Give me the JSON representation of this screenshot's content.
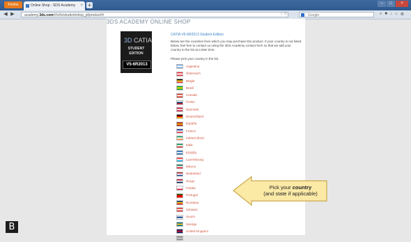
{
  "browser": {
    "menu_button": "Firefox",
    "tab_title": "Online Shop - SDS Academy",
    "url_prefix": "academy.",
    "url_domain": "3ds.com",
    "url_path": "/#/s/fs/student/shop_pl/product/4",
    "search_placeholder": "Google"
  },
  "shop": {
    "heading": "3DS ACADEMY ONLINE SHOP",
    "box": {
      "logo": "CATIA",
      "student": "STUDENT",
      "edition": "EDITION",
      "version": "V5-6R2013"
    },
    "product_title": "CATIA V5-6R2013 Student Edition",
    "intro": "Below are the countries from which you may purchase this product. If your country is not listed below, feel free to contact us using the 3DS Academy contact form so that we add your country to the list at a later time.",
    "instruction": "Please pick your country in the list.",
    "countries": [
      {
        "name": "Argentina",
        "flag": [
          "#74acdf",
          "#ffffff",
          "#74acdf"
        ]
      },
      {
        "name": "Österreich",
        "flag": [
          "#ed2939",
          "#ffffff",
          "#ed2939"
        ]
      },
      {
        "name": "België",
        "flag": [
          "#000000",
          "#fdda24",
          "#ef3340"
        ]
      },
      {
        "name": "Brazil",
        "flag": [
          "#009c3b",
          "#ffdf00",
          "#009c3b"
        ]
      },
      {
        "name": "Canada",
        "flag": [
          "#d52b1e",
          "#ffffff",
          "#d52b1e"
        ]
      },
      {
        "name": "Česko",
        "flag": [
          "#ffffff",
          "#11457e",
          "#d7141a"
        ]
      },
      {
        "name": "Danmark",
        "flag": [
          "#c60c30",
          "#ffffff",
          "#c60c30"
        ]
      },
      {
        "name": "Deutschland",
        "flag": [
          "#000000",
          "#dd0000",
          "#ffce00"
        ]
      },
      {
        "name": "España",
        "flag": [
          "#aa151b",
          "#f1bf00",
          "#aa151b"
        ]
      },
      {
        "name": "France",
        "flag": [
          "#002395",
          "#ffffff",
          "#ed2939"
        ]
      },
      {
        "name": "Ireland (Éire)",
        "flag": [
          "#169b62",
          "#ffffff",
          "#ff883e"
        ]
      },
      {
        "name": "Italia",
        "flag": [
          "#009246",
          "#ffffff",
          "#ce2b37"
        ]
      },
      {
        "name": "Eλλάδα",
        "flag": [
          "#0d5eaf",
          "#ffffff",
          "#0d5eaf"
        ]
      },
      {
        "name": "Luxembourg",
        "flag": [
          "#ed2939",
          "#ffffff",
          "#00a1de"
        ]
      },
      {
        "name": "México",
        "flag": [
          "#006847",
          "#ffffff",
          "#ce1126"
        ]
      },
      {
        "name": "Nederland",
        "flag": [
          "#ae1c28",
          "#ffffff",
          "#21468b"
        ]
      },
      {
        "name": "Norge",
        "flag": [
          "#ba0c2f",
          "#ffffff",
          "#00205b"
        ]
      },
      {
        "name": "Polska",
        "flag": [
          "#ffffff",
          "#ffffff",
          "#dc143c"
        ]
      },
      {
        "name": "Portugal",
        "flag": [
          "#006600",
          "#ff0000",
          "#ff0000"
        ]
      },
      {
        "name": "România",
        "flag": [
          "#002b7f",
          "#fcd116",
          "#ce1126"
        ]
      },
      {
        "name": "Schweiz",
        "flag": [
          "#d52b1e",
          "#ffffff",
          "#d52b1e"
        ]
      },
      {
        "name": "Suomi",
        "flag": [
          "#ffffff",
          "#003580",
          "#ffffff"
        ]
      },
      {
        "name": "Sverige",
        "flag": [
          "#006aa7",
          "#fecc00",
          "#006aa7"
        ]
      },
      {
        "name": "United Kingdom",
        "flag": [
          "#012169",
          "#c8102e",
          "#012169"
        ]
      },
      {
        "name": "",
        "flag": [
          "#888888",
          "#cccccc",
          "#888888"
        ]
      }
    ]
  },
  "callout": {
    "line1_prefix": "Pick your ",
    "line1_bold": "country",
    "line2": "(and state if applicable)",
    "fill_color": "#fbe9a6",
    "stroke_color": "#c9a94d"
  },
  "overlay_badge": "B"
}
